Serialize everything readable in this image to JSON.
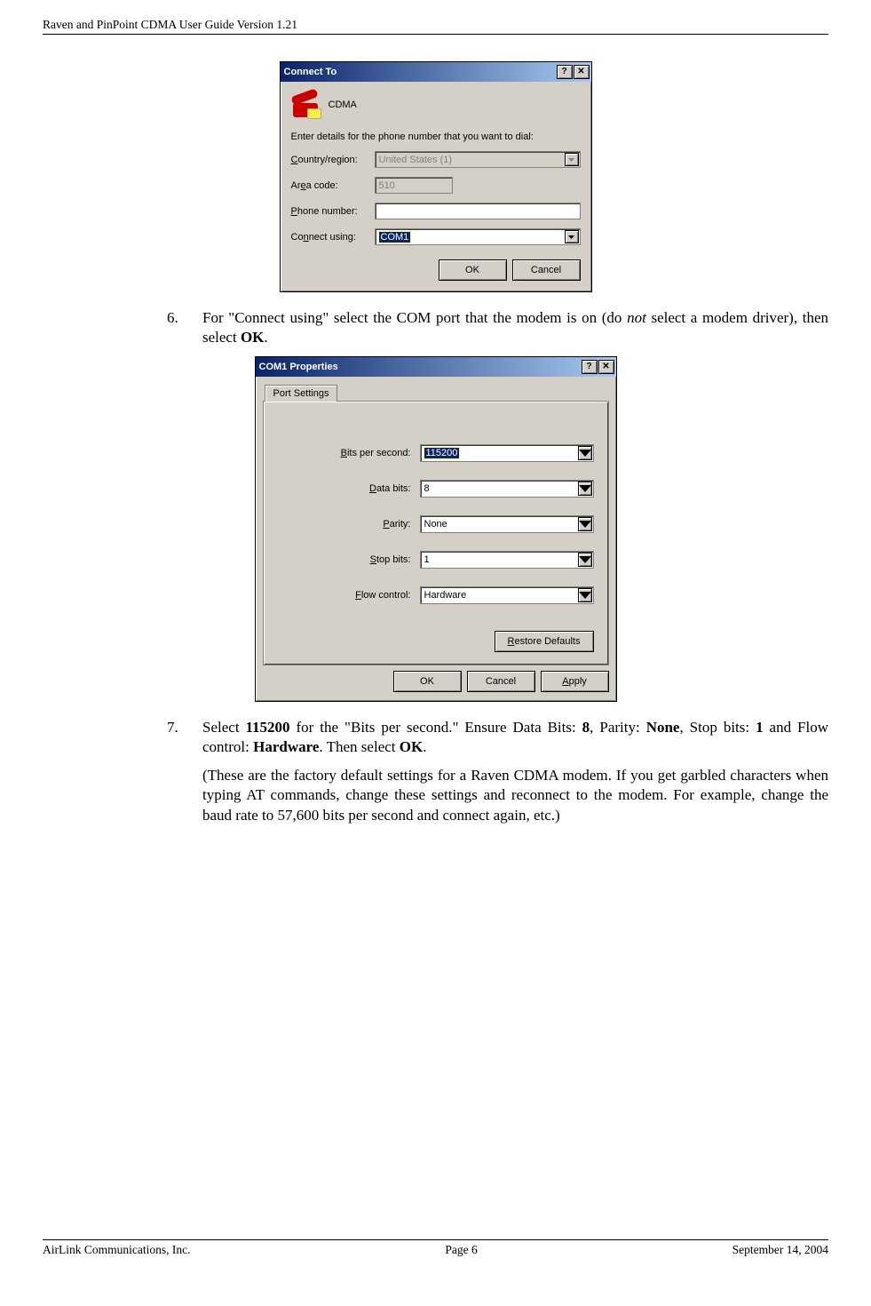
{
  "header": "Raven and PinPoint CDMA User Guide Version 1.21",
  "footer": {
    "left": "AirLink Communications, Inc.",
    "center": "Page 6",
    "right": "September 14, 2004"
  },
  "dlg1": {
    "title": "Connect To",
    "name": "CDMA",
    "instruction": "Enter details for the phone number that you want to dial:",
    "labels": {
      "country": "ountry/region:",
      "area": "a code:",
      "phone": "hone number:",
      "connect": "nect using:"
    },
    "values": {
      "country": "United States (1)",
      "area": "510",
      "phone": "",
      "connect": "COM1"
    },
    "buttons": {
      "ok": "OK",
      "cancel": "Cancel"
    }
  },
  "dlg2": {
    "title": "COM1 Properties",
    "tab": "Port Settings",
    "labels": {
      "bits": "its per second:",
      "data": "ata bits:",
      "parity": "arity:",
      "stop": "top bits:",
      "flow": "low control:"
    },
    "values": {
      "bits": "115200",
      "data": "8",
      "parity": "None",
      "stop": "1",
      "flow": "Hardware"
    },
    "buttons": {
      "restore": "estore Defaults",
      "ok": "OK",
      "cancel": "Cancel",
      "apply": "pply"
    }
  },
  "steps": [
    {
      "num": "6.",
      "t1": "For \"Connect using\" select the COM port that the modem is on (do ",
      "i1": "not",
      "t2": " select a modem driver), then select ",
      "b1": "OK",
      "t3": "."
    },
    {
      "num": "7.",
      "t1": "Select ",
      "b1": "115200",
      "t2": " for the \"Bits per second.\" Ensure Data Bits: ",
      "b2": "8",
      "t3": ", Parity: ",
      "b3": "None",
      "t4": ", Stop bits: ",
      "b4": "1",
      "t5": " and Flow control: ",
      "b5": "Hardware",
      "t6": ". Then select ",
      "b6": "OK",
      "t7": ".",
      "note": "(These are the factory default settings for a Raven CDMA modem. If you get garbled characters when typing AT commands, change these settings and reconnect to the modem. For example, change the baud rate to 57,600 bits per second and connect again, etc.)"
    }
  ]
}
